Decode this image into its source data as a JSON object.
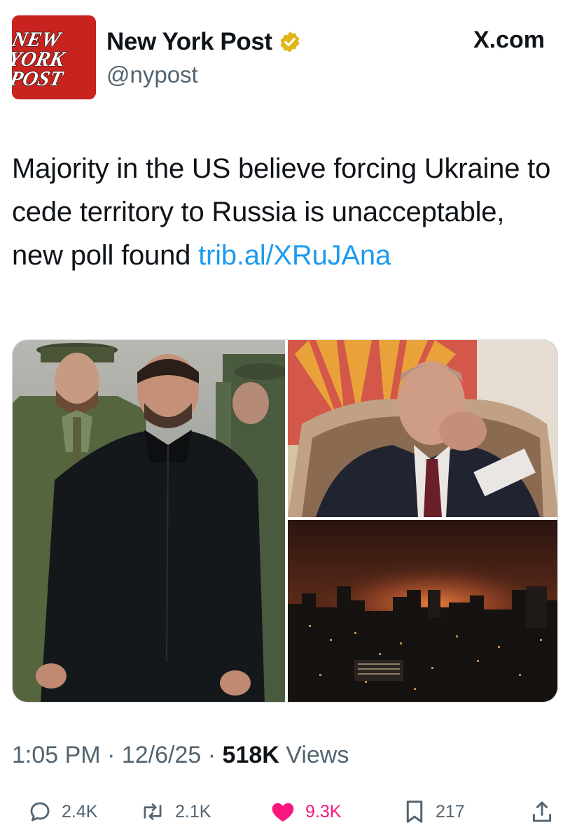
{
  "author": {
    "display_name": "New York Post",
    "handle": "@nypost",
    "verified": true,
    "avatar_text": [
      "NEW",
      "YORK",
      "POST"
    ],
    "avatar_color": "#c8231f",
    "badge_color": "#e2b719"
  },
  "platform_label": "X.com",
  "tweet": {
    "text": "Majority in the US believe forcing Ukraine to cede territory to Russia is unacceptable, new poll found",
    "link": "trib.al/XRuJAna"
  },
  "media": {
    "images": [
      {
        "icon": "photo-zelensky-honor-guard"
      },
      {
        "icon": "photo-putin-seated"
      },
      {
        "icon": "photo-night-city-explosion"
      }
    ]
  },
  "meta": {
    "time": "1:05 PM",
    "separator": "·",
    "date": "12/6/25",
    "views_count": "518K",
    "views_label": "Views"
  },
  "actions": {
    "replies": "2.4K",
    "reposts": "2.1K",
    "likes": "9.3K",
    "bookmarks": "217",
    "liked": true,
    "like_color": "#f91880"
  },
  "colors": {
    "text": "#0f1419",
    "secondary": "#536471",
    "link": "#1d9bf0"
  }
}
